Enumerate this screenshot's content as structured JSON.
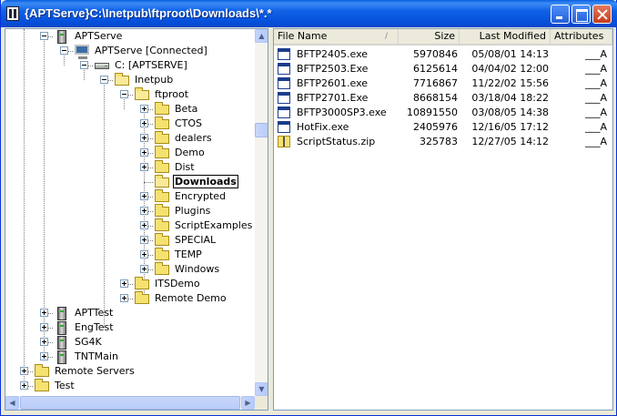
{
  "window": {
    "title": "{APTServe}C:\\Inetpub\\ftproot\\Downloads\\*.*"
  },
  "tree": {
    "nodes": [
      {
        "label": "APTServe",
        "icon": "server-icon",
        "depth": 1,
        "expander": "minus"
      },
      {
        "label": "APTServe [Connected]",
        "icon": "computer-icon",
        "depth": 2,
        "expander": "minus"
      },
      {
        "label": "C: [APTSERVE]",
        "icon": "drive-icon",
        "depth": 3,
        "expander": "minus"
      },
      {
        "label": "Inetpub",
        "icon": "folder-open-icon",
        "depth": 4,
        "expander": "minus"
      },
      {
        "label": "ftproot",
        "icon": "folder-open-icon",
        "depth": 5,
        "expander": "minus"
      },
      {
        "label": "Beta",
        "icon": "folder-icon",
        "depth": 6,
        "expander": "plus"
      },
      {
        "label": "CTOS",
        "icon": "folder-icon",
        "depth": 6,
        "expander": "plus"
      },
      {
        "label": "dealers",
        "icon": "folder-icon",
        "depth": 6,
        "expander": "plus"
      },
      {
        "label": "Demo",
        "icon": "folder-icon",
        "depth": 6,
        "expander": "plus"
      },
      {
        "label": "Dist",
        "icon": "folder-icon",
        "depth": 6,
        "expander": "plus"
      },
      {
        "label": "Downloads",
        "icon": "folder-open-icon",
        "depth": 6,
        "expander": "none",
        "selected": true
      },
      {
        "label": "Encrypted",
        "icon": "folder-icon",
        "depth": 6,
        "expander": "plus"
      },
      {
        "label": "Plugins",
        "icon": "folder-icon",
        "depth": 6,
        "expander": "plus"
      },
      {
        "label": "ScriptExamples",
        "icon": "folder-icon",
        "depth": 6,
        "expander": "plus"
      },
      {
        "label": "SPECIAL",
        "icon": "folder-icon",
        "depth": 6,
        "expander": "plus"
      },
      {
        "label": "TEMP",
        "icon": "folder-icon",
        "depth": 6,
        "expander": "plus"
      },
      {
        "label": "Windows",
        "icon": "folder-icon",
        "depth": 6,
        "expander": "plus"
      },
      {
        "label": "ITSDemo",
        "icon": "folder-icon",
        "depth": 5,
        "expander": "plus"
      },
      {
        "label": "Remote Demo",
        "icon": "folder-icon",
        "depth": 5,
        "expander": "plus"
      },
      {
        "label": "APTTest",
        "icon": "server-icon",
        "depth": 1,
        "expander": "plus"
      },
      {
        "label": "EngTest",
        "icon": "server-icon",
        "depth": 1,
        "expander": "plus"
      },
      {
        "label": "SG4K",
        "icon": "server-icon",
        "depth": 1,
        "expander": "plus"
      },
      {
        "label": "TNTMain",
        "icon": "server-icon",
        "depth": 1,
        "expander": "plus"
      },
      {
        "label": "Remote Servers",
        "icon": "folder-icon",
        "depth": 0,
        "expander": "plus"
      },
      {
        "label": "Test",
        "icon": "folder-icon",
        "depth": 0,
        "expander": "plus"
      }
    ]
  },
  "list": {
    "columns": {
      "name": "File Name",
      "size": "Size",
      "modified": "Last Modified",
      "attributes": "Attributes"
    },
    "files": [
      {
        "name": "BFTP2405.exe",
        "size": "5970846",
        "modified": "05/08/01  14:13",
        "attributes": "___A",
        "icon": "exe-icon"
      },
      {
        "name": "BFTP2503.Exe",
        "size": "6125614",
        "modified": "04/04/02  12:00",
        "attributes": "___A",
        "icon": "exe-icon"
      },
      {
        "name": "BFTP2601.exe",
        "size": "7716867",
        "modified": "11/22/02  15:56",
        "attributes": "___A",
        "icon": "exe-icon"
      },
      {
        "name": "BFTP2701.Exe",
        "size": "8668154",
        "modified": "03/18/04  18:22",
        "attributes": "___A",
        "icon": "exe-icon"
      },
      {
        "name": "BFTP3000SP3.exe",
        "size": "10891550",
        "modified": "03/08/05  14:38",
        "attributes": "___A",
        "icon": "exe-icon"
      },
      {
        "name": "HotFix.exe",
        "size": "2405976",
        "modified": "12/16/05  17:12",
        "attributes": "___A",
        "icon": "exe-icon"
      },
      {
        "name": "ScriptStatus.zip",
        "size": "325783",
        "modified": "12/27/05  14:12",
        "attributes": "___A",
        "icon": "zip-icon"
      }
    ]
  }
}
